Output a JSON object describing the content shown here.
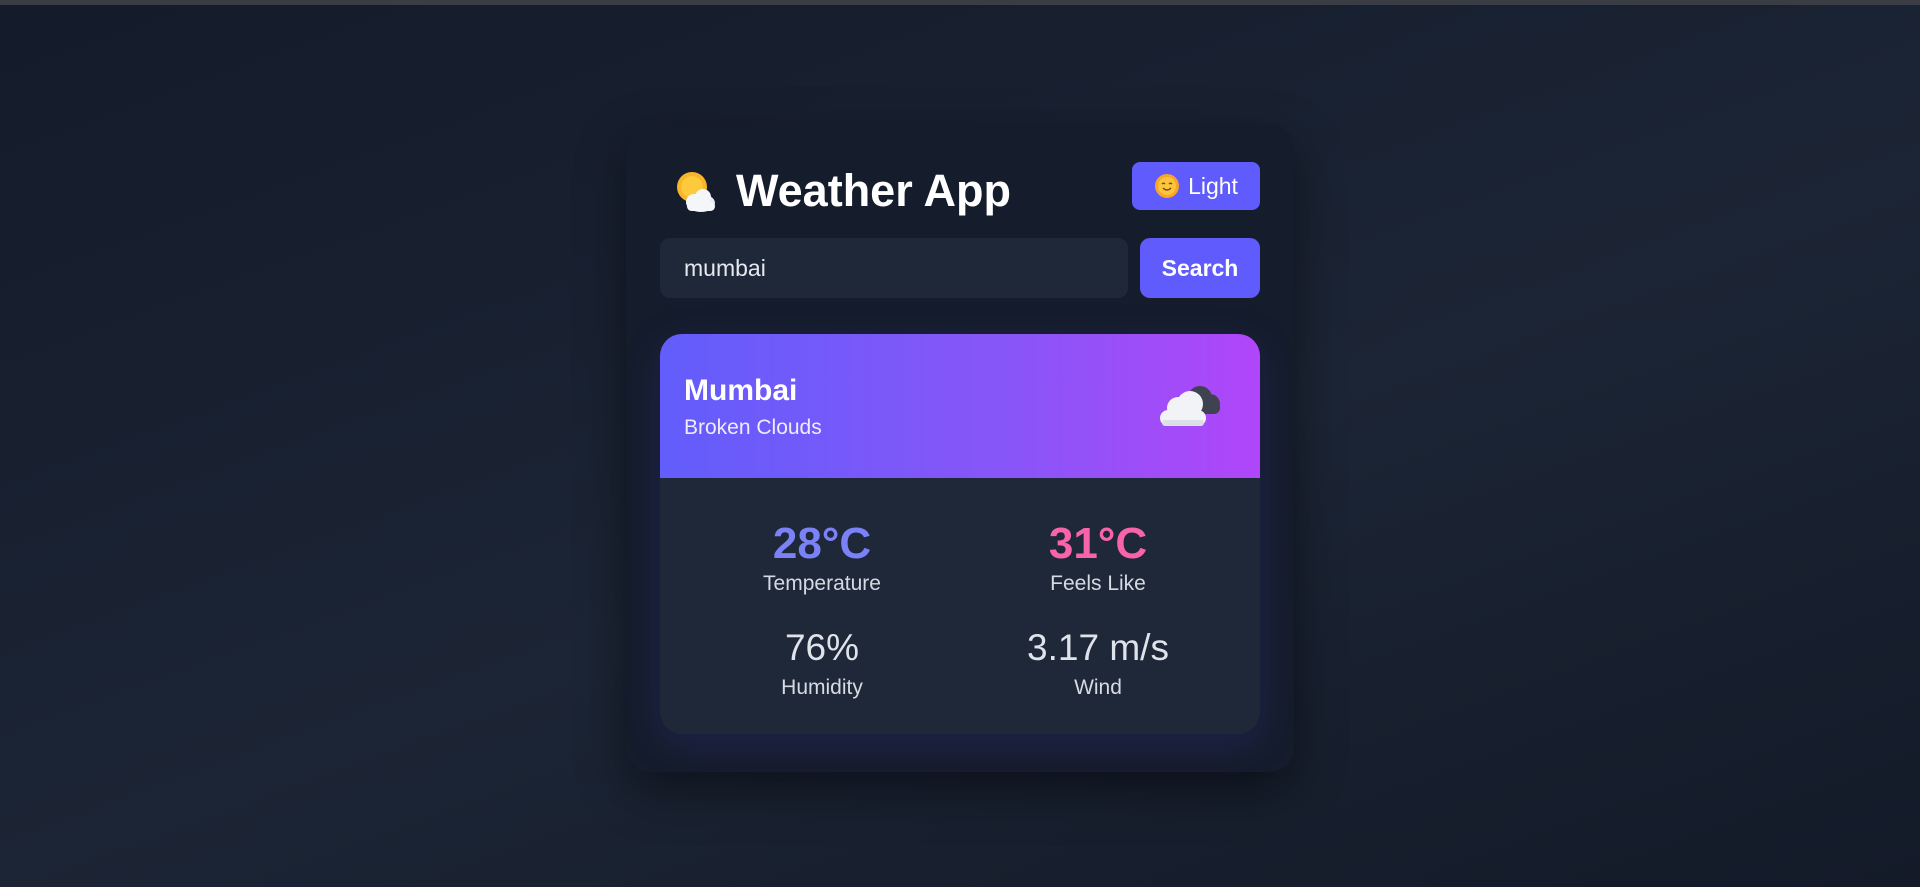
{
  "app": {
    "title": "Weather App",
    "logo_icon": "sun-behind-cloud-icon"
  },
  "theme_toggle": {
    "icon": "sun-with-face-icon",
    "label": "Light"
  },
  "search": {
    "value": "mumbai",
    "button_label": "Search"
  },
  "weather": {
    "city": "Mumbai",
    "condition": "Broken Clouds",
    "condition_icon": "cloud-icon",
    "stats": {
      "temperature": {
        "value": "28°C",
        "label": "Temperature",
        "color": "#7b82f7"
      },
      "feels_like": {
        "value": "31°C",
        "label": "Feels Like",
        "color": "#f864a7"
      },
      "humidity": {
        "value": "76%",
        "label": "Humidity"
      },
      "wind": {
        "value": "3.17 m/s",
        "label": "Wind"
      }
    }
  },
  "colors": {
    "accent": "#5f5bfd",
    "banner_start": "#625dfb",
    "banner_end": "#b046f9",
    "card_bg": "#151c2b"
  }
}
